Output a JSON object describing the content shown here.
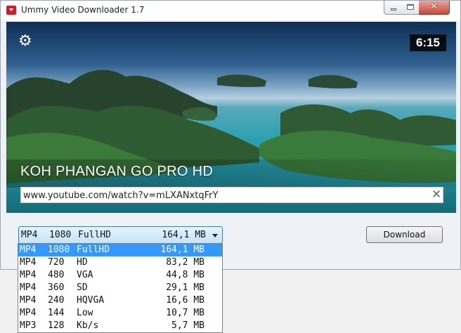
{
  "window": {
    "title": "Ummy Video Downloader 1.7",
    "close_glyph": "✕"
  },
  "video": {
    "title": "KOH PHANGAN GO PRO HD",
    "duration": "6:15",
    "settings_icon": "gear-icon"
  },
  "url": {
    "value": "www.youtube.com/watch?v=mLXANxtqFrY",
    "clear_glyph": "✕"
  },
  "format_select": {
    "selected": {
      "container": "MP4",
      "res": "1080",
      "label": "FullHD",
      "size": "164,1 MB"
    }
  },
  "download_label": "Download",
  "formats": [
    {
      "container": "MP4",
      "res": "1080",
      "label": "FullHD",
      "size": "164,1 MB"
    },
    {
      "container": "MP4",
      "res": "720",
      "label": "HD",
      "size": "83,2 MB"
    },
    {
      "container": "MP4",
      "res": "480",
      "label": "VGA",
      "size": "44,8 MB"
    },
    {
      "container": "MP4",
      "res": "360",
      "label": "SD",
      "size": "29,1 MB"
    },
    {
      "container": "MP4",
      "res": "240",
      "label": "HQVGA",
      "size": "16,6 MB"
    },
    {
      "container": "MP4",
      "res": "144",
      "label": "Low",
      "size": "10,7 MB"
    },
    {
      "container": "MP3",
      "res": "128",
      "label": "Kb/s",
      "size": "5,7 MB"
    }
  ],
  "colors": {
    "highlight": "#3399ff",
    "close_button": "#c7473a"
  }
}
